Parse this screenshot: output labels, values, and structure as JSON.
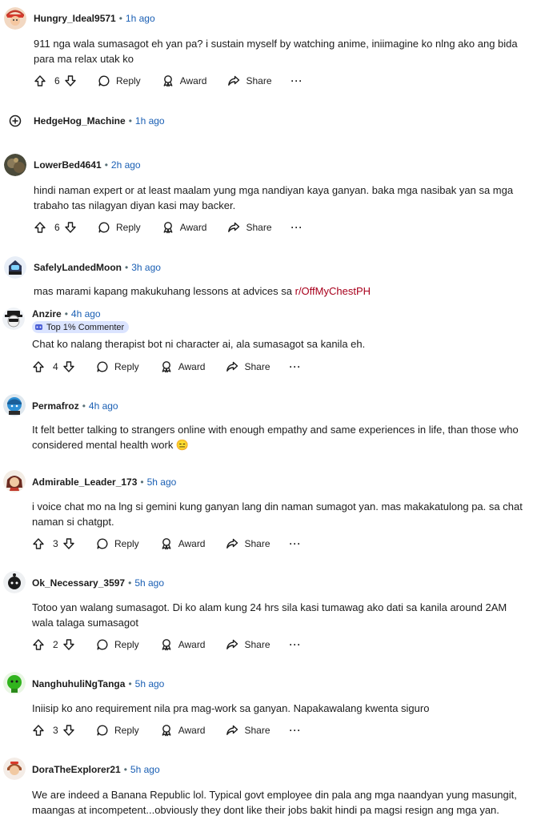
{
  "actions": {
    "reply": "Reply",
    "award": "Award",
    "share": "Share",
    "more": "···"
  },
  "comments": [
    {
      "user": "Hungry_Ideal9571",
      "time": "1h ago",
      "lines": [
        "911 nga wala sumasagot eh yan pa? i sustain myself by watching anime, iniimagine ko nlng ako ang bida",
        "para ma relax utak ko"
      ],
      "votes": "6"
    },
    {
      "user": "HedgeHog_Machine",
      "time": "1h ago"
    },
    {
      "user": "LowerBed4641",
      "time": "2h ago",
      "lines": [
        "hindi naman expert or at least maalam yung mga nandiyan kaya ganyan. baka mga nasibak yan sa mga",
        "trabaho tas nilagyan diyan kasi may backer."
      ],
      "votes": "6"
    },
    {
      "user": "SafelyLandedMoon",
      "time": "3h ago",
      "line_prefix": "mas marami kapang makukuhang lessons at advices sa ",
      "subreddit": "r/OffMyChestPH"
    },
    {
      "user": "Anzire",
      "time": "4h ago",
      "badge": "Top 1% Commenter",
      "lines": [
        "Chat ko nalang therapist bot ni character ai, ala sumasagot sa kanila eh."
      ],
      "votes": "4"
    },
    {
      "user": "Permafroz",
      "time": "4h ago",
      "lines": [
        "It felt better talking to strangers online with enough empathy and same experiences in life, than those who",
        "considered mental health work 😑"
      ]
    },
    {
      "user": "Admirable_Leader_173",
      "time": "5h ago",
      "lines": [
        "i voice chat mo na lng si gemini kung ganyan lang din naman sumagot yan. mas makakatulong pa. sa chat",
        "naman si chatgpt."
      ],
      "votes": "3"
    },
    {
      "user": "Ok_Necessary_3597",
      "time": "5h ago",
      "lines": [
        "Totoo yan walang sumasagot. Di ko alam kung 24 hrs sila kasi tumawag ako dati sa kanila around 2AM",
        "wala talaga sumasagot"
      ],
      "votes": "2"
    },
    {
      "user": "NanghuhuliNgTanga",
      "time": "5h ago",
      "lines": [
        "Iniisip ko ano requirement nila pra mag-work sa ganyan. Napakawalang kwenta siguro"
      ],
      "votes": "3"
    },
    {
      "user": "DoraTheExplorer21",
      "time": "5h ago",
      "lines": [
        "We are indeed a Banana Republic lol. Typical govt employee din pala ang mga naandyan yung masungit,",
        "maangas at incompetent...obviously they dont like their jobs bakit hindi pa magsi resign ang mga yan."
      ]
    }
  ]
}
